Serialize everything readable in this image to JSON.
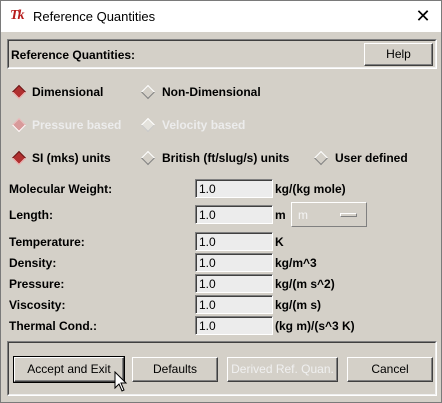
{
  "window": {
    "title": "Reference Quantities",
    "close_glyph": "✕",
    "logo_text": "Tk"
  },
  "header": {
    "title": "Reference Quantities:",
    "help_label": "Help"
  },
  "dimension_mode": {
    "options": [
      {
        "label": "Dimensional",
        "selected": true
      },
      {
        "label": "Non-Dimensional",
        "selected": false
      }
    ]
  },
  "basis": {
    "enabled": false,
    "options": [
      {
        "label": "Pressure based",
        "selected": true
      },
      {
        "label": "Velocity based",
        "selected": false
      }
    ]
  },
  "units": {
    "options": [
      {
        "label": "SI (mks) units",
        "selected": true
      },
      {
        "label": "British (ft/slug/s) units",
        "selected": false
      },
      {
        "label": "User defined",
        "selected": false
      }
    ]
  },
  "fields": [
    {
      "label": "Molecular Weight:",
      "value": "1.0",
      "unit": "kg/(kg mole)"
    },
    {
      "label": "Length:",
      "value": "1.0",
      "unit": "m"
    },
    {
      "label": "Temperature:",
      "value": "1.0",
      "unit": "K"
    },
    {
      "label": "Density:",
      "value": "1.0",
      "unit": "kg/m^3"
    },
    {
      "label": "Pressure:",
      "value": "1.0",
      "unit": "kg/(m s^2)"
    },
    {
      "label": "Viscosity:",
      "value": "1.0",
      "unit": "kg/(m s)"
    },
    {
      "label": "Thermal Cond.:",
      "value": "1.0",
      "unit": "(kg m)/(s^3 K)"
    }
  ],
  "length_unit_menu": {
    "value": "m",
    "enabled": false
  },
  "buttons": {
    "accept": "Accept and Exit",
    "defaults": "Defaults",
    "derived": "Derived Ref. Quan.",
    "cancel": "Cancel"
  },
  "colors": {
    "accent_radio": "#b03030",
    "background": "#d4d0c8"
  }
}
